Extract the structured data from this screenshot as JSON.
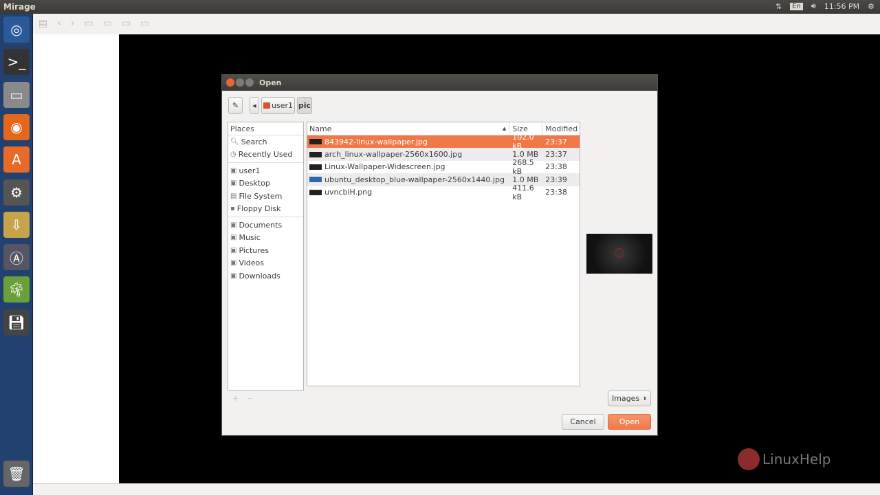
{
  "app_title": "Mirage",
  "tray": {
    "time": "11:56 PM",
    "keyboard": "En",
    "icons": [
      "network-icon",
      "keyboard-icon",
      "volume-icon",
      "power-icon"
    ]
  },
  "launcher": [
    "ubuntu-icon",
    "terminal-icon",
    "files-icon",
    "firefox-icon",
    "software-center-icon",
    "settings-icon",
    "archive-icon",
    "update-icon",
    "mirage-icon",
    "save-icon",
    "trash-icon"
  ],
  "dialog": {
    "title": "Open",
    "path": [
      "user1",
      "pic"
    ],
    "places_header": "Places",
    "places": [
      [
        "Search",
        "Recently Used"
      ],
      [
        "user1",
        "Desktop",
        "File System",
        "Floppy Disk"
      ],
      [
        "Documents",
        "Music",
        "Pictures",
        "Videos",
        "Downloads"
      ]
    ],
    "columns": {
      "name": "Name",
      "size": "Size",
      "modified": "Modified"
    },
    "files": [
      {
        "name": "843942-linux-wallpaper.jpg",
        "size": "102.0 kB",
        "modified": "23:37",
        "selected": true
      },
      {
        "name": "arch_linux-wallpaper-2560x1600.jpg",
        "size": "1.0 MB",
        "modified": "23:37"
      },
      {
        "name": "Linux-Wallpaper-Widescreen.jpg",
        "size": "268.5 kB",
        "modified": "23:38"
      },
      {
        "name": "ubuntu_desktop_blue-wallpaper-2560x1440.jpg",
        "size": "1.0 MB",
        "modified": "23:39"
      },
      {
        "name": "uvncbiH.png",
        "size": "411.6 kB",
        "modified": "23:38"
      }
    ],
    "filter": "Images",
    "cancel": "Cancel",
    "open": "Open",
    "accent": "#f07746"
  },
  "watermark": "LinuxHelp"
}
